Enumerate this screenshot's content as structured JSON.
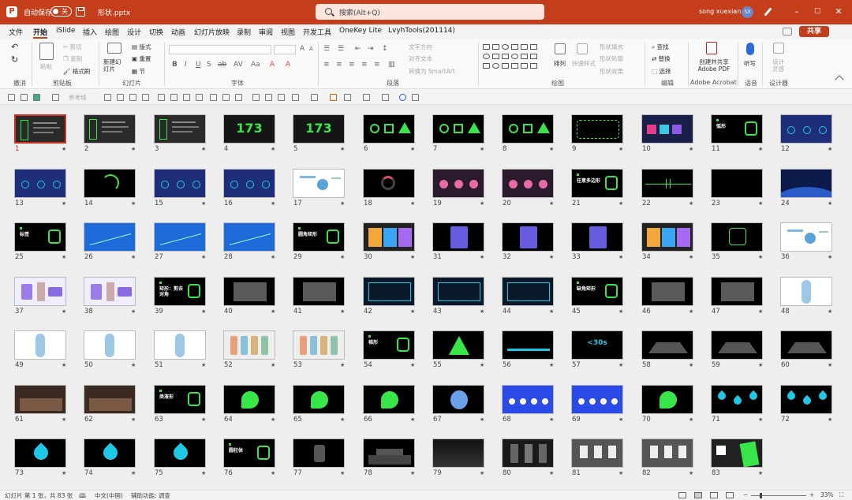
{
  "titlebar": {
    "autosave": "自动保存",
    "autosave_state": "关",
    "title": "形状.pptx",
    "search_placeholder": "搜索(Alt+Q)",
    "user": "song xuexian",
    "avatar": "SX"
  },
  "menu": [
    "文件",
    "开始",
    "iSlide",
    "插入",
    "绘图",
    "设计",
    "切换",
    "动画",
    "幻灯片放映",
    "录制",
    "审阅",
    "视图",
    "开发工具",
    "OneKey Lite",
    "LvyhTools(201114)"
  ],
  "share_label": "共享",
  "ribbon": {
    "undo": "撤消",
    "paste": "粘贴",
    "cut": "剪切",
    "copy": "复制",
    "format_painter": "格式刷",
    "new_slide": "新建幻灯片",
    "layout": "版式",
    "reset": "重置",
    "section": "节",
    "text_direction": "文字方向",
    "align_text": "对齐文本",
    "smartart": "转换为 SmartArt",
    "arrange": "排列",
    "quick_styles": "快速样式",
    "shape_fill": "形状填充",
    "shape_outline": "形状轮廓",
    "shape_effects": "形状效果",
    "find": "查找",
    "replace": "替换",
    "select": "选择",
    "adobe": "创建并共享 Adobe PDF",
    "dictate": "听写",
    "designer": "设计灵感",
    "groups": [
      "撤消",
      "剪贴板",
      "幻灯片",
      "字体",
      "段落",
      "绘图",
      "编辑",
      "Adobe Acrobat",
      "语音",
      "设计器"
    ]
  },
  "qat_ref_line": "参考线",
  "slides": [
    {
      "n": "1",
      "t": "doc"
    },
    {
      "n": "2",
      "t": "doc"
    },
    {
      "n": "3",
      "t": "doc"
    },
    {
      "n": "4",
      "t": "num"
    },
    {
      "n": "5",
      "t": "num"
    },
    {
      "n": "6",
      "t": "shapes"
    },
    {
      "n": "7",
      "t": "shapes"
    },
    {
      "n": "8",
      "t": "shapes"
    },
    {
      "n": "9",
      "t": "shapes2"
    },
    {
      "n": "10",
      "t": "colorful"
    },
    {
      "n": "11",
      "t": "label"
    },
    {
      "n": "12",
      "t": "blue"
    },
    {
      "n": "13",
      "t": "blue"
    },
    {
      "n": "14",
      "t": "arc"
    },
    {
      "n": "15",
      "t": "blue"
    },
    {
      "n": "16",
      "t": "blue"
    },
    {
      "n": "17",
      "t": "white"
    },
    {
      "n": "18",
      "t": "ring"
    },
    {
      "n": "19",
      "t": "pink"
    },
    {
      "n": "20",
      "t": "pink"
    },
    {
      "n": "21",
      "t": "label"
    },
    {
      "n": "22",
      "t": "line"
    },
    {
      "n": "23",
      "t": "black"
    },
    {
      "n": "24",
      "t": "earth"
    },
    {
      "n": "25",
      "t": "label"
    },
    {
      "n": "26",
      "t": "chartblue"
    },
    {
      "n": "27",
      "t": "chartblue"
    },
    {
      "n": "28",
      "t": "chartblue"
    },
    {
      "n": "29",
      "t": "label"
    },
    {
      "n": "30",
      "t": "cards"
    },
    {
      "n": "31",
      "t": "purple"
    },
    {
      "n": "32",
      "t": "purple"
    },
    {
      "n": "33",
      "t": "purple"
    },
    {
      "n": "34",
      "t": "cards"
    },
    {
      "n": "35",
      "t": "outline"
    },
    {
      "n": "36",
      "t": "white"
    },
    {
      "n": "37",
      "t": "whitecard"
    },
    {
      "n": "38",
      "t": "whitecard"
    },
    {
      "n": "39",
      "t": "label"
    },
    {
      "n": "40",
      "t": "grayrect"
    },
    {
      "n": "41",
      "t": "grayrect"
    },
    {
      "n": "42",
      "t": "cyanframe"
    },
    {
      "n": "43",
      "t": "cyanframe"
    },
    {
      "n": "44",
      "t": "cyanframe"
    },
    {
      "n": "45",
      "t": "label"
    },
    {
      "n": "46",
      "t": "grayrect"
    },
    {
      "n": "47",
      "t": "grayrect"
    },
    {
      "n": "48",
      "t": "pill"
    },
    {
      "n": "49",
      "t": "pill"
    },
    {
      "n": "50",
      "t": "pill"
    },
    {
      "n": "51",
      "t": "pill"
    },
    {
      "n": "52",
      "t": "bottles"
    },
    {
      "n": "53",
      "t": "bottles"
    },
    {
      "n": "54",
      "t": "label"
    },
    {
      "n": "55",
      "t": "tri"
    },
    {
      "n": "56",
      "t": "cyanbar"
    },
    {
      "n": "57",
      "t": "cyantext"
    },
    {
      "n": "58",
      "t": "trap"
    },
    {
      "n": "59",
      "t": "trap"
    },
    {
      "n": "60",
      "t": "trap"
    },
    {
      "n": "61",
      "t": "photo"
    },
    {
      "n": "62",
      "t": "photo"
    },
    {
      "n": "63",
      "t": "label"
    },
    {
      "n": "64",
      "t": "greenblob"
    },
    {
      "n": "65",
      "t": "greenblob"
    },
    {
      "n": "66",
      "t": "greenblob"
    },
    {
      "n": "67",
      "t": "portrait"
    },
    {
      "n": "68",
      "t": "bluefill"
    },
    {
      "n": "69",
      "t": "bluefill"
    },
    {
      "n": "70",
      "t": "greenblob"
    },
    {
      "n": "71",
      "t": "drops"
    },
    {
      "n": "72",
      "t": "drops"
    },
    {
      "n": "73",
      "t": "drop"
    },
    {
      "n": "74",
      "t": "drop"
    },
    {
      "n": "75",
      "t": "drop"
    },
    {
      "n": "76",
      "t": "label"
    },
    {
      "n": "77",
      "t": "cyl"
    },
    {
      "n": "78",
      "t": "steps"
    },
    {
      "n": "79",
      "t": "darkgray"
    },
    {
      "n": "80",
      "t": "stage"
    },
    {
      "n": "81",
      "t": "gallery"
    },
    {
      "n": "82",
      "t": "gallery"
    },
    {
      "n": "83",
      "t": "phone"
    }
  ],
  "slide_texts": {
    "4": "173",
    "5": "173",
    "11": "弧形",
    "21": "任意多边形",
    "25": "标签",
    "29": "圆角矩形",
    "39": "矩形：剪去对角",
    "45": "缺角矩形",
    "54": "梯形",
    "57": "<30s",
    "63": "类液形",
    "76": "圆柱体"
  },
  "status": {
    "slide_info": "幻灯片 第 1 张，共 83 张",
    "language": "中文(中国)",
    "accessibility": "辅助功能: 调查",
    "zoom": "33%"
  },
  "colors": {
    "accent": "#c43e1c",
    "green": "#39e64a",
    "cyan": "#1ec9e6",
    "blue": "#1e2e7a"
  }
}
